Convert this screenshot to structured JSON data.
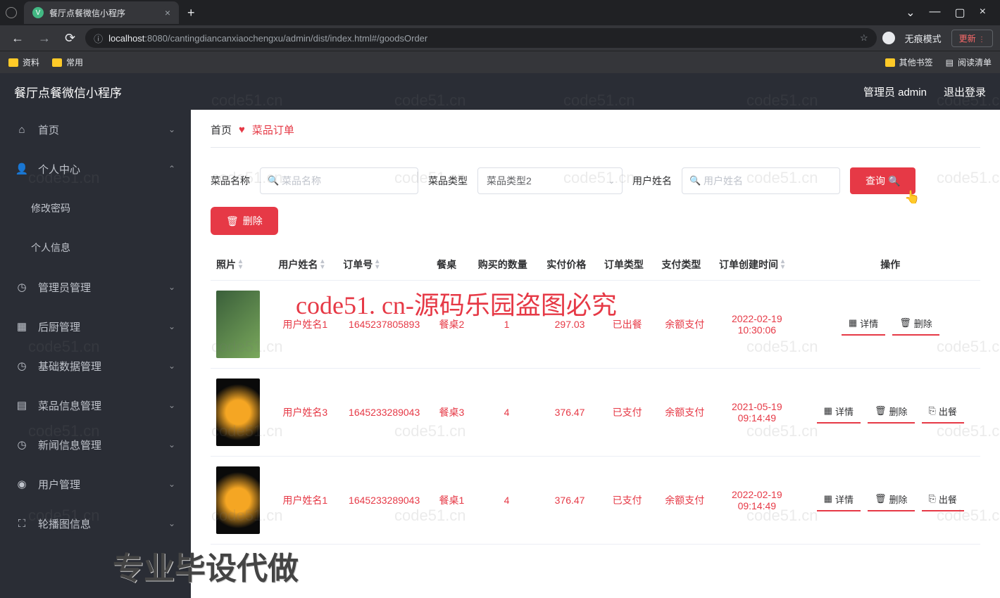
{
  "browser": {
    "tab_title": "餐厅点餐微信小程序",
    "url_host": "localhost",
    "url_port_path": ":8080/cantingdiancanxiaochengxu/admin/dist/index.html#/goodsOrder",
    "incognito": "无痕模式",
    "update": "更新",
    "bookmarks": {
      "b1": "资料",
      "b2": "常用",
      "other": "其他书签",
      "reading": "阅读清单"
    }
  },
  "header": {
    "title": "餐厅点餐微信小程序",
    "user": "管理员 admin",
    "logout": "退出登录"
  },
  "sidebar": {
    "items": [
      {
        "label": "首页",
        "icon": "⌂"
      },
      {
        "label": "个人中心",
        "icon": "👤",
        "expand": true
      },
      {
        "label": "修改密码",
        "sub": true
      },
      {
        "label": "个人信息",
        "sub": true
      },
      {
        "label": "管理员管理",
        "icon": "◷"
      },
      {
        "label": "后厨管理",
        "icon": "▦"
      },
      {
        "label": "基础数据管理",
        "icon": "◷"
      },
      {
        "label": "菜品信息管理",
        "icon": "▤"
      },
      {
        "label": "新闻信息管理",
        "icon": "◷"
      },
      {
        "label": "用户管理",
        "icon": "◉"
      },
      {
        "label": "轮播图信息",
        "icon": "⛶"
      }
    ]
  },
  "breadcrumb": {
    "home": "首页",
    "current": "菜品订单"
  },
  "filters": {
    "name_label": "菜品名称",
    "name_ph": "菜品名称",
    "type_label": "菜品类型",
    "type_value": "菜品类型2",
    "user_label": "用户姓名",
    "user_ph": "用户姓名",
    "query": "查询"
  },
  "buttons": {
    "delete": "删除"
  },
  "table": {
    "headers": {
      "photo": "照片",
      "user": "用户姓名",
      "order": "订单号",
      "table": "餐桌",
      "qty": "购买的数量",
      "price": "实付价格",
      "otype": "订单类型",
      "ptype": "支付类型",
      "created": "订单创建时间",
      "action": "操作"
    },
    "actions": {
      "detail": "详情",
      "delete": "删除",
      "serve": "出餐"
    },
    "rows": [
      {
        "user": "用户姓名1",
        "order": "1645237805893",
        "table": "餐桌2",
        "qty": "1",
        "price": "297.03",
        "otype": "已出餐",
        "ptype": "余额支付",
        "created": "2022-02-19 10:30:06",
        "acts": [
          "detail",
          "delete"
        ]
      },
      {
        "user": "用户姓名3",
        "order": "1645233289043",
        "table": "餐桌3",
        "qty": "4",
        "price": "376.47",
        "otype": "已支付",
        "ptype": "余额支付",
        "created": "2021-05-19 09:14:49",
        "acts": [
          "detail",
          "delete",
          "serve"
        ]
      },
      {
        "user": "用户姓名1",
        "order": "1645233289043",
        "table": "餐桌1",
        "qty": "4",
        "price": "376.47",
        "otype": "已支付",
        "ptype": "余额支付",
        "created": "2022-02-19 09:14:49",
        "acts": [
          "detail",
          "delete",
          "serve"
        ]
      }
    ]
  },
  "watermark": {
    "big": "code51. cn-源码乐园盗图必究",
    "bottom": "专业毕设代做",
    "tile": "code51.cn"
  }
}
